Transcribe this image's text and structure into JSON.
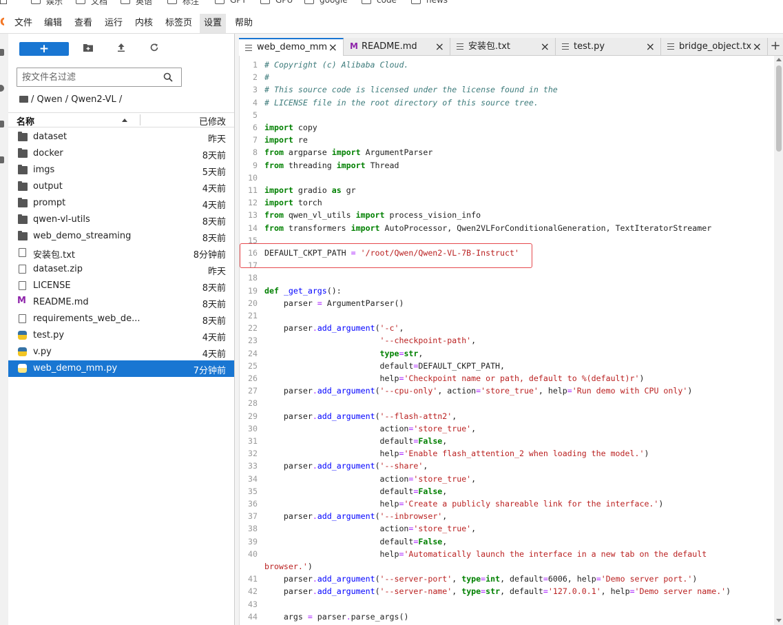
{
  "bookmarks": [
    "娱乐",
    "文档",
    "英语",
    "标注",
    "GPT",
    "GPU",
    "google",
    "code",
    "news"
  ],
  "menu": [
    "文件",
    "编辑",
    "查看",
    "运行",
    "内核",
    "标签页",
    "设置",
    "帮助"
  ],
  "filebrowser": {
    "new_label": "+",
    "filter_placeholder": "按文件名过滤",
    "breadcrumb": "/ Qwen / Qwen2-VL /",
    "col_name": "名称",
    "col_modified": "已修改",
    "files": [
      {
        "name": "dataset",
        "type": "folder",
        "modified": "昨天"
      },
      {
        "name": "docker",
        "type": "folder",
        "modified": "8天前"
      },
      {
        "name": "imgs",
        "type": "folder",
        "modified": "5天前"
      },
      {
        "name": "output",
        "type": "folder",
        "modified": "4天前"
      },
      {
        "name": "prompt",
        "type": "folder",
        "modified": "4天前"
      },
      {
        "name": "qwen-vl-utils",
        "type": "folder",
        "modified": "8天前"
      },
      {
        "name": "web_demo_streaming",
        "type": "folder",
        "modified": "8天前"
      },
      {
        "name": "安装包.txt",
        "type": "file",
        "modified": "8分钟前"
      },
      {
        "name": "dataset.zip",
        "type": "file",
        "modified": "昨天"
      },
      {
        "name": "LICENSE",
        "type": "file",
        "modified": "8天前"
      },
      {
        "name": "README.md",
        "type": "markdown",
        "modified": "8天前"
      },
      {
        "name": "requirements_web_de...",
        "type": "file",
        "modified": "8天前"
      },
      {
        "name": "test.py",
        "type": "python",
        "modified": "4天前"
      },
      {
        "name": "v.py",
        "type": "python",
        "modified": "4天前"
      },
      {
        "name": "web_demo_mm.py",
        "type": "python",
        "modified": "7分钟前",
        "selected": true
      }
    ]
  },
  "tabs": [
    {
      "label": "web_demo_mm.",
      "icon": "lines",
      "active": true
    },
    {
      "label": "README.md",
      "icon": "markdown"
    },
    {
      "label": "安装包.txt",
      "icon": "lines"
    },
    {
      "label": "test.py",
      "icon": "lines"
    },
    {
      "label": "bridge_object.txt",
      "icon": "lines"
    }
  ],
  "new_tab": "+",
  "code_lines": [
    [
      [
        "c",
        "# Copyright (c) Alibaba Cloud."
      ]
    ],
    [
      [
        "c",
        "#"
      ]
    ],
    [
      [
        "c",
        "# This source code is licensed under the license found in the"
      ]
    ],
    [
      [
        "c",
        "# LICENSE file in the root directory of this source tree."
      ]
    ],
    [],
    [
      [
        "k",
        "import"
      ],
      [
        "p",
        " copy"
      ]
    ],
    [
      [
        "k",
        "import"
      ],
      [
        "p",
        " re"
      ]
    ],
    [
      [
        "k",
        "from"
      ],
      [
        "p",
        " argparse "
      ],
      [
        "k",
        "import"
      ],
      [
        "p",
        " ArgumentParser"
      ]
    ],
    [
      [
        "k",
        "from"
      ],
      [
        "p",
        " threading "
      ],
      [
        "k",
        "import"
      ],
      [
        "p",
        " Thread"
      ]
    ],
    [],
    [
      [
        "k",
        "import"
      ],
      [
        "p",
        " gradio "
      ],
      [
        "k",
        "as"
      ],
      [
        "p",
        " gr"
      ]
    ],
    [
      [
        "k",
        "import"
      ],
      [
        "p",
        " torch"
      ]
    ],
    [
      [
        "k",
        "from"
      ],
      [
        "p",
        " qwen_vl_utils "
      ],
      [
        "k",
        "import"
      ],
      [
        "p",
        " process_vision_info"
      ]
    ],
    [
      [
        "k",
        "from"
      ],
      [
        "p",
        " transformers "
      ],
      [
        "k",
        "import"
      ],
      [
        "p",
        " AutoProcessor, Qwen2VLForConditionalGeneration, TextIteratorStreamer"
      ]
    ],
    [],
    [
      [
        "p",
        "DEFAULT_CKPT_PATH "
      ],
      [
        "o",
        "="
      ],
      [
        "p",
        " "
      ],
      [
        "s",
        "'/root/Qwen/Qwen2-VL-7B-Instruct'"
      ]
    ],
    [],
    [],
    [
      [
        "k",
        "def"
      ],
      [
        "p",
        " "
      ],
      [
        "f",
        "_get_args"
      ],
      [
        "p",
        "():"
      ]
    ],
    [
      [
        "p",
        "    parser "
      ],
      [
        "o",
        "="
      ],
      [
        "p",
        " ArgumentParser()"
      ]
    ],
    [],
    [
      [
        "p",
        "    parser"
      ],
      [
        "o",
        "."
      ],
      [
        "f",
        "add_argument"
      ],
      [
        "p",
        "("
      ],
      [
        "s",
        "'-c'"
      ],
      [
        "p",
        ","
      ]
    ],
    [
      [
        "p",
        "                        "
      ],
      [
        "s",
        "'--checkpoint-path'"
      ],
      [
        "p",
        ","
      ]
    ],
    [
      [
        "p",
        "                        "
      ],
      [
        "n",
        "type"
      ],
      [
        "o",
        "="
      ],
      [
        "n",
        "str"
      ],
      [
        "p",
        ","
      ]
    ],
    [
      [
        "p",
        "                        default"
      ],
      [
        "o",
        "="
      ],
      [
        "p",
        "DEFAULT_CKPT_PATH,"
      ]
    ],
    [
      [
        "p",
        "                        help"
      ],
      [
        "o",
        "="
      ],
      [
        "s",
        "'Checkpoint name or path, default to %(default)r'"
      ],
      [
        "p",
        ")"
      ]
    ],
    [
      [
        "p",
        "    parser"
      ],
      [
        "o",
        "."
      ],
      [
        "f",
        "add_argument"
      ],
      [
        "p",
        "("
      ],
      [
        "s",
        "'--cpu-only'"
      ],
      [
        "p",
        ", action"
      ],
      [
        "o",
        "="
      ],
      [
        "s",
        "'store_true'"
      ],
      [
        "p",
        ", help"
      ],
      [
        "o",
        "="
      ],
      [
        "s",
        "'Run demo with CPU only'"
      ],
      [
        "p",
        ")"
      ]
    ],
    [],
    [
      [
        "p",
        "    parser"
      ],
      [
        "o",
        "."
      ],
      [
        "f",
        "add_argument"
      ],
      [
        "p",
        "("
      ],
      [
        "s",
        "'--flash-attn2'"
      ],
      [
        "p",
        ","
      ]
    ],
    [
      [
        "p",
        "                        action"
      ],
      [
        "o",
        "="
      ],
      [
        "s",
        "'store_true'"
      ],
      [
        "p",
        ","
      ]
    ],
    [
      [
        "p",
        "                        default"
      ],
      [
        "o",
        "="
      ],
      [
        "n",
        "False"
      ],
      [
        "p",
        ","
      ]
    ],
    [
      [
        "p",
        "                        help"
      ],
      [
        "o",
        "="
      ],
      [
        "s",
        "'Enable flash_attention_2 when loading the model.'"
      ],
      [
        "p",
        ")"
      ]
    ],
    [
      [
        "p",
        "    parser"
      ],
      [
        "o",
        "."
      ],
      [
        "f",
        "add_argument"
      ],
      [
        "p",
        "("
      ],
      [
        "s",
        "'--share'"
      ],
      [
        "p",
        ","
      ]
    ],
    [
      [
        "p",
        "                        action"
      ],
      [
        "o",
        "="
      ],
      [
        "s",
        "'store_true'"
      ],
      [
        "p",
        ","
      ]
    ],
    [
      [
        "p",
        "                        default"
      ],
      [
        "o",
        "="
      ],
      [
        "n",
        "False"
      ],
      [
        "p",
        ","
      ]
    ],
    [
      [
        "p",
        "                        help"
      ],
      [
        "o",
        "="
      ],
      [
        "s",
        "'Create a publicly shareable link for the interface.'"
      ],
      [
        "p",
        ")"
      ]
    ],
    [
      [
        "p",
        "    parser"
      ],
      [
        "o",
        "."
      ],
      [
        "f",
        "add_argument"
      ],
      [
        "p",
        "("
      ],
      [
        "s",
        "'--inbrowser'"
      ],
      [
        "p",
        ","
      ]
    ],
    [
      [
        "p",
        "                        action"
      ],
      [
        "o",
        "="
      ],
      [
        "s",
        "'store_true'"
      ],
      [
        "p",
        ","
      ]
    ],
    [
      [
        "p",
        "                        default"
      ],
      [
        "o",
        "="
      ],
      [
        "n",
        "False"
      ],
      [
        "p",
        ","
      ]
    ],
    [
      [
        "p",
        "                        help"
      ],
      [
        "o",
        "="
      ],
      [
        "s",
        "'Automatically launch the interface in a new tab on the default"
      ]
    ],
    [
      [
        "s",
        "browser.'"
      ],
      [
        "p",
        ")"
      ]
    ],
    [
      [
        "p",
        "    parser"
      ],
      [
        "o",
        "."
      ],
      [
        "f",
        "add_argument"
      ],
      [
        "p",
        "("
      ],
      [
        "s",
        "'--server-port'"
      ],
      [
        "p",
        ", "
      ],
      [
        "n",
        "type"
      ],
      [
        "o",
        "="
      ],
      [
        "n",
        "int"
      ],
      [
        "p",
        ", default"
      ],
      [
        "o",
        "="
      ],
      [
        "p",
        "6006, help"
      ],
      [
        "o",
        "="
      ],
      [
        "s",
        "'Demo server port.'"
      ],
      [
        "p",
        ")"
      ]
    ],
    [
      [
        "p",
        "    parser"
      ],
      [
        "o",
        "."
      ],
      [
        "f",
        "add_argument"
      ],
      [
        "p",
        "("
      ],
      [
        "s",
        "'--server-name'"
      ],
      [
        "p",
        ", "
      ],
      [
        "n",
        "type"
      ],
      [
        "o",
        "="
      ],
      [
        "n",
        "str"
      ],
      [
        "p",
        ", default"
      ],
      [
        "o",
        "="
      ],
      [
        "s",
        "'127.0.0.1'"
      ],
      [
        "p",
        ", help"
      ],
      [
        "o",
        "="
      ],
      [
        "s",
        "'Demo server name.'"
      ],
      [
        "p",
        ")"
      ]
    ],
    [],
    [
      [
        "p",
        "    args "
      ],
      [
        "o",
        "="
      ],
      [
        "p",
        " parser"
      ],
      [
        "o",
        "."
      ],
      [
        "p",
        "parse_args()"
      ]
    ]
  ],
  "line_numbers": [
    "1",
    "2",
    "3",
    "4",
    "5",
    "6",
    "7",
    "8",
    "9",
    "10",
    "11",
    "12",
    "13",
    "14",
    "15",
    "16",
    "17",
    "18",
    "19",
    "20",
    "21",
    "22",
    "23",
    "24",
    "25",
    "26",
    "27",
    "28",
    "29",
    "30",
    "31",
    "32",
    "33",
    "34",
    "35",
    "36",
    "37",
    "38",
    "39",
    "40",
    "",
    "41",
    "42",
    "43",
    "44"
  ],
  "colors": {
    "accent": "#1976d2",
    "highlight_box": "#e5484d"
  }
}
